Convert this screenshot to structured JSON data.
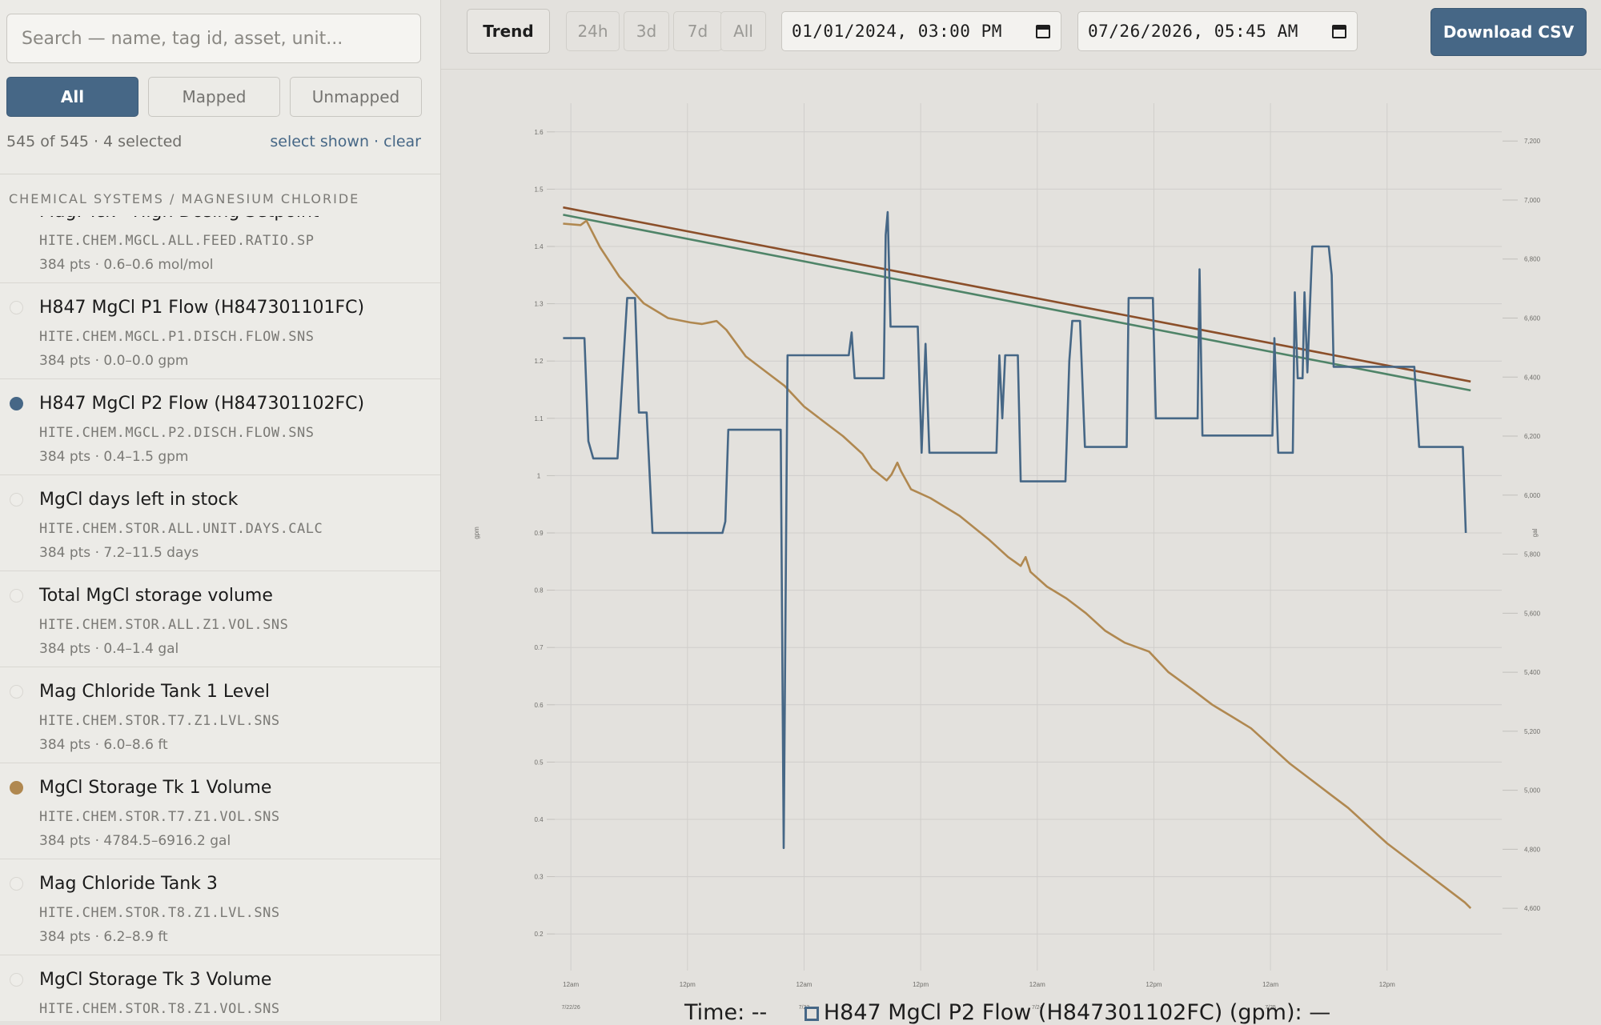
{
  "sidebar": {
    "search_placeholder": "Search — name, tag id, asset, unit...",
    "filters": [
      "All",
      "Mapped",
      "Unmapped"
    ],
    "active_filter": "All",
    "counts": "545 of 545 · 4 selected",
    "select_shown": "select shown",
    "separator": " · ",
    "clear": "clear",
    "group": "CHEMICAL SYSTEMS / MAGNESIUM CHLORIDE",
    "items": [
      {
        "name": "Mag. Tck - High Dosing Setpoint",
        "tag": "HITE.CHEM.MGCL.ALL.FEED.RATIO.SP",
        "meta": "384 pts · 0.6–0.6 mol/mol",
        "selected": false,
        "color": ""
      },
      {
        "name": "H847 MgCl P1 Flow (H847301101FC)",
        "tag": "HITE.CHEM.MGCL.P1.DISCH.FLOW.SNS",
        "meta": "384 pts · 0.0–0.0 gpm",
        "selected": false,
        "color": ""
      },
      {
        "name": "H847 MgCl P2 Flow (H847301102FC)",
        "tag": "HITE.CHEM.MGCL.P2.DISCH.FLOW.SNS",
        "meta": "384 pts · 0.4–1.5 gpm",
        "selected": true,
        "color": "#466786"
      },
      {
        "name": "MgCl days left in stock",
        "tag": "HITE.CHEM.STOR.ALL.UNIT.DAYS.CALC",
        "meta": "384 pts · 7.2–11.5 days",
        "selected": false,
        "color": ""
      },
      {
        "name": "Total MgCl storage volume",
        "tag": "HITE.CHEM.STOR.ALL.Z1.VOL.SNS",
        "meta": "384 pts · 0.4–1.4 gal",
        "selected": false,
        "color": ""
      },
      {
        "name": "Mag Chloride Tank 1 Level",
        "tag": "HITE.CHEM.STOR.T7.Z1.LVL.SNS",
        "meta": "384 pts · 6.0–8.6 ft",
        "selected": false,
        "color": ""
      },
      {
        "name": "MgCl Storage Tk 1 Volume",
        "tag": "HITE.CHEM.STOR.T7.Z1.VOL.SNS",
        "meta": "384 pts · 4784.5–6916.2 gal",
        "selected": true,
        "color": "#b08850"
      },
      {
        "name": "Mag Chloride Tank 3",
        "tag": "HITE.CHEM.STOR.T8.Z1.LVL.SNS",
        "meta": "384 pts · 6.2–8.9 ft",
        "selected": false,
        "color": ""
      },
      {
        "name": "MgCl Storage Tk 3 Volume",
        "tag": "HITE.CHEM.STOR.T8.Z1.VOL.SNS",
        "meta": "",
        "selected": false,
        "color": ""
      }
    ]
  },
  "toolbar": {
    "trend": "Trend",
    "ranges": [
      "24h",
      "3d",
      "7d",
      "All"
    ],
    "start": "01/01/2024, 03:00 PM",
    "end": "07/26/2026, 05:45 AM",
    "download": "Download CSV"
  },
  "legend": {
    "time_label": "Time:",
    "time_value": "--",
    "series_label": "H847 MgCl P2 Flow (H847301102FC) (gpm):",
    "series_value": "—"
  },
  "chart_data": {
    "type": "line",
    "x_ticks": [
      {
        "t": 0,
        "time": "12am",
        "date": "7/22/26"
      },
      {
        "t": 12,
        "time": "12pm",
        "date": ""
      },
      {
        "t": 24,
        "time": "12am",
        "date": "7/23"
      },
      {
        "t": 36,
        "time": "12pm",
        "date": ""
      },
      {
        "t": 48,
        "time": "12am",
        "date": "7/24"
      },
      {
        "t": 60,
        "time": "12pm",
        "date": ""
      },
      {
        "t": 72,
        "time": "12am",
        "date": "7/25"
      },
      {
        "t": 84,
        "time": "12pm",
        "date": ""
      }
    ],
    "x_range": [
      -1,
      95.8
    ],
    "y_left": {
      "label": "gpm",
      "range": [
        0.15,
        1.65
      ],
      "ticks": [
        0.2,
        0.3,
        0.4,
        0.5,
        0.6,
        0.7,
        0.8,
        0.9,
        1,
        1.1,
        1.2,
        1.3,
        1.4,
        1.5,
        1.6
      ]
    },
    "y_right": {
      "label": "gal",
      "range": [
        4416,
        7328
      ],
      "ticks": [
        4600,
        4800,
        5000,
        5200,
        5400,
        5600,
        5800,
        6000,
        6200,
        6400,
        6600,
        6800,
        7000,
        7200
      ]
    },
    "grid": true,
    "series": [
      {
        "name": "H847 MgCl P2 Flow (H847301102FC)",
        "axis": "left",
        "color": "#466786",
        "points": [
          [
            -0.8,
            1.24
          ],
          [
            1.4,
            1.24
          ],
          [
            1.8,
            1.06
          ],
          [
            2.3,
            1.03
          ],
          [
            4.8,
            1.03
          ],
          [
            5.8,
            1.31
          ],
          [
            6.6,
            1.31
          ],
          [
            7.0,
            1.11
          ],
          [
            7.8,
            1.11
          ],
          [
            8.4,
            0.9
          ],
          [
            15.6,
            0.9
          ],
          [
            15.9,
            0.92
          ],
          [
            16.2,
            1.08
          ],
          [
            21.6,
            1.08
          ],
          [
            21.9,
            0.35
          ],
          [
            22.3,
            1.21
          ],
          [
            28.6,
            1.21
          ],
          [
            28.9,
            1.25
          ],
          [
            29.2,
            1.17
          ],
          [
            32.2,
            1.17
          ],
          [
            32.4,
            1.42
          ],
          [
            32.6,
            1.46
          ],
          [
            32.9,
            1.26
          ],
          [
            35.7,
            1.26
          ],
          [
            36.1,
            1.04
          ],
          [
            36.5,
            1.23
          ],
          [
            36.9,
            1.04
          ],
          [
            43.8,
            1.04
          ],
          [
            44.1,
            1.21
          ],
          [
            44.4,
            1.1
          ],
          [
            44.7,
            1.21
          ],
          [
            46.0,
            1.21
          ],
          [
            46.3,
            0.99
          ],
          [
            50.9,
            0.99
          ],
          [
            51.3,
            1.2
          ],
          [
            51.6,
            1.27
          ],
          [
            52.4,
            1.27
          ],
          [
            52.9,
            1.05
          ],
          [
            57.2,
            1.05
          ],
          [
            57.4,
            1.31
          ],
          [
            59.9,
            1.31
          ],
          [
            60.2,
            1.1
          ],
          [
            64.5,
            1.1
          ],
          [
            64.7,
            1.36
          ],
          [
            65.0,
            1.07
          ],
          [
            72.2,
            1.07
          ],
          [
            72.4,
            1.24
          ],
          [
            72.8,
            1.04
          ],
          [
            74.3,
            1.04
          ],
          [
            74.5,
            1.32
          ],
          [
            74.8,
            1.17
          ],
          [
            75.3,
            1.17
          ],
          [
            75.5,
            1.32
          ],
          [
            75.8,
            1.18
          ],
          [
            76.3,
            1.4
          ],
          [
            78.0,
            1.4
          ],
          [
            78.3,
            1.35
          ],
          [
            78.5,
            1.19
          ],
          [
            86.8,
            1.19
          ],
          [
            87.3,
            1.05
          ],
          [
            91.8,
            1.05
          ],
          [
            92.1,
            0.9
          ]
        ]
      },
      {
        "name": "MgCl Storage Tk 1 Volume",
        "axis": "right",
        "color": "#b08850",
        "points": [
          [
            -0.8,
            6920
          ],
          [
            1.0,
            6915
          ],
          [
            1.6,
            6930
          ],
          [
            3.0,
            6840
          ],
          [
            5.0,
            6740
          ],
          [
            7.5,
            6650
          ],
          [
            10.0,
            6600
          ],
          [
            12.3,
            6585
          ],
          [
            13.5,
            6580
          ],
          [
            15.0,
            6590
          ],
          [
            16.0,
            6560
          ],
          [
            18.0,
            6470
          ],
          [
            20.0,
            6420
          ],
          [
            22.0,
            6370
          ],
          [
            24.0,
            6300
          ],
          [
            26.0,
            6250
          ],
          [
            28.0,
            6200
          ],
          [
            30.0,
            6140
          ],
          [
            31.0,
            6090
          ],
          [
            32.5,
            6050
          ],
          [
            33.0,
            6070
          ],
          [
            33.6,
            6110
          ],
          [
            34.0,
            6080
          ],
          [
            35.0,
            6020
          ],
          [
            37.0,
            5990
          ],
          [
            40.0,
            5930
          ],
          [
            43.0,
            5850
          ],
          [
            45.0,
            5790
          ],
          [
            46.3,
            5760
          ],
          [
            46.8,
            5790
          ],
          [
            47.3,
            5740
          ],
          [
            49.0,
            5690
          ],
          [
            51.0,
            5650
          ],
          [
            53.0,
            5600
          ],
          [
            55.0,
            5540
          ],
          [
            57.0,
            5500
          ],
          [
            59.5,
            5470
          ],
          [
            61.5,
            5400
          ],
          [
            64.0,
            5340
          ],
          [
            66.0,
            5290
          ],
          [
            68.0,
            5250
          ],
          [
            70.0,
            5210
          ],
          [
            72.0,
            5150
          ],
          [
            74.0,
            5090
          ],
          [
            76.0,
            5040
          ],
          [
            78.0,
            4990
          ],
          [
            80.0,
            4940
          ],
          [
            82.0,
            4880
          ],
          [
            84.0,
            4820
          ],
          [
            86.0,
            4770
          ],
          [
            88.0,
            4720
          ],
          [
            90.0,
            4670
          ],
          [
            92.0,
            4620
          ],
          [
            92.6,
            4600
          ]
        ]
      },
      {
        "name": "",
        "axis": "right",
        "color": "#8b4f2a",
        "points": [
          [
            -0.8,
            6975
          ],
          [
            92.6,
            6385
          ]
        ]
      },
      {
        "name": "",
        "axis": "right",
        "color": "#4f8468",
        "points": [
          [
            -0.8,
            6950
          ],
          [
            92.6,
            6355
          ]
        ]
      }
    ]
  }
}
